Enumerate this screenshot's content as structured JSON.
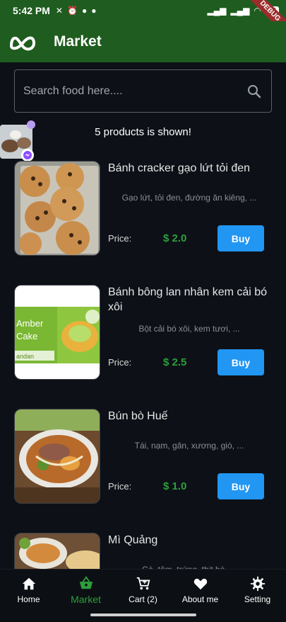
{
  "status_bar": {
    "time": "5:42 PM",
    "battery": "65"
  },
  "debug_banner": "DEBUG",
  "app_bar": {
    "title": "Market"
  },
  "search": {
    "placeholder": "Search food here...."
  },
  "product_count_text": "5 products is shown!",
  "price_label": "Price:",
  "buy_label": "Buy",
  "products": [
    {
      "name": "Bánh cracker gạo lứt tỏi đen",
      "description": "Gạo lứt, tỏi đen, đường ăn kiêng, ...",
      "price": "$ 2.0"
    },
    {
      "name": "Bánh bông lan nhân kem cải bó xôi",
      "description": "Bột cải bó xôi, kem tươi, ...",
      "price": "$ 2.5"
    },
    {
      "name": "Bún bò Huế",
      "description": "Tái, nạm, gân, xương, giò, ...",
      "price": "$ 1.0"
    },
    {
      "name": "Mì Quảng",
      "description": "Gà, tôm, trứng, thịt bò, ...",
      "price": ""
    }
  ],
  "bottom_nav": [
    {
      "label": "Home",
      "icon": "home-icon",
      "active": false
    },
    {
      "label": "Market",
      "icon": "basket-icon",
      "active": true
    },
    {
      "label": "Cart (2)",
      "icon": "cart-icon",
      "active": false
    },
    {
      "label": "About me",
      "icon": "heart-icon",
      "active": false
    },
    {
      "label": "Setting",
      "icon": "gear-icon",
      "active": false
    }
  ],
  "colors": {
    "app_bar": "#1f5c1f",
    "accent": "#2e9e3c",
    "buy": "#2196f3",
    "background": "#0d1117"
  }
}
